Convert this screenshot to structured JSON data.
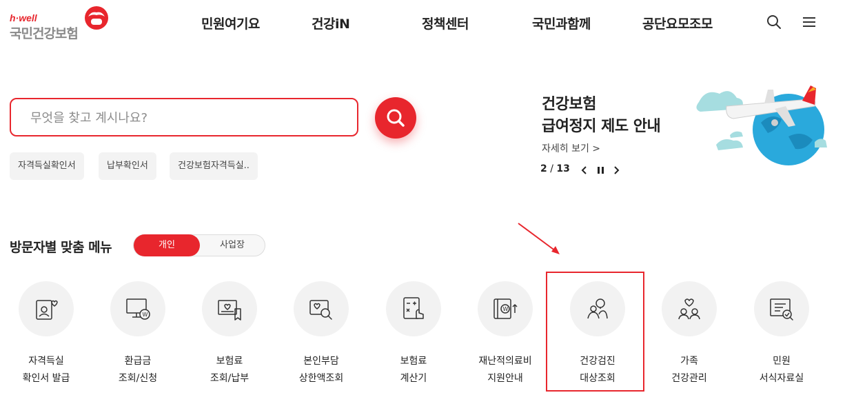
{
  "logo": {
    "tagline": "h·well",
    "name": "국민건강보험"
  },
  "nav": {
    "items": [
      "민원여기요",
      "건강iN",
      "정책센터",
      "국민과함께",
      "공단요모조모"
    ]
  },
  "search": {
    "placeholder": "무엇을 찾고 계시나요?",
    "value": ""
  },
  "quick_chips": [
    "자격득실확인서",
    "납부확인서",
    "건강보험자격득실.."
  ],
  "banner": {
    "title_line1": "건강보험",
    "title_line2": "급여정지 제도 안내",
    "link": "자세히 보기 >",
    "current": "2",
    "separator": "/",
    "total": "13"
  },
  "persona": {
    "title": "방문자별 맞춤 메뉴",
    "toggle_active": "개인",
    "toggle_inactive": "사업장"
  },
  "menu": [
    {
      "label": "자격득실\n확인서 발급",
      "icon": "id-card-heart-icon"
    },
    {
      "label": "환급금\n조회/신청",
      "icon": "monitor-won-icon"
    },
    {
      "label": "보험료\n조회/납부",
      "icon": "bill-heart-icon"
    },
    {
      "label": "본인부담\n상한액조회",
      "icon": "card-search-icon"
    },
    {
      "label": "보험료\n계산기",
      "icon": "calculator-hand-icon"
    },
    {
      "label": "재난적의료비\n지원안내",
      "icon": "book-won-icon"
    },
    {
      "label": "건강검진\n대상조회",
      "icon": "people-search-icon"
    },
    {
      "label": "가족\n건강관리",
      "icon": "family-heart-icon"
    },
    {
      "label": "민원\n서식자료실",
      "icon": "document-check-icon"
    }
  ],
  "colors": {
    "accent": "#e8262d",
    "circle_bg": "#f2f2f2",
    "chip_bg": "#f3f3f3"
  }
}
